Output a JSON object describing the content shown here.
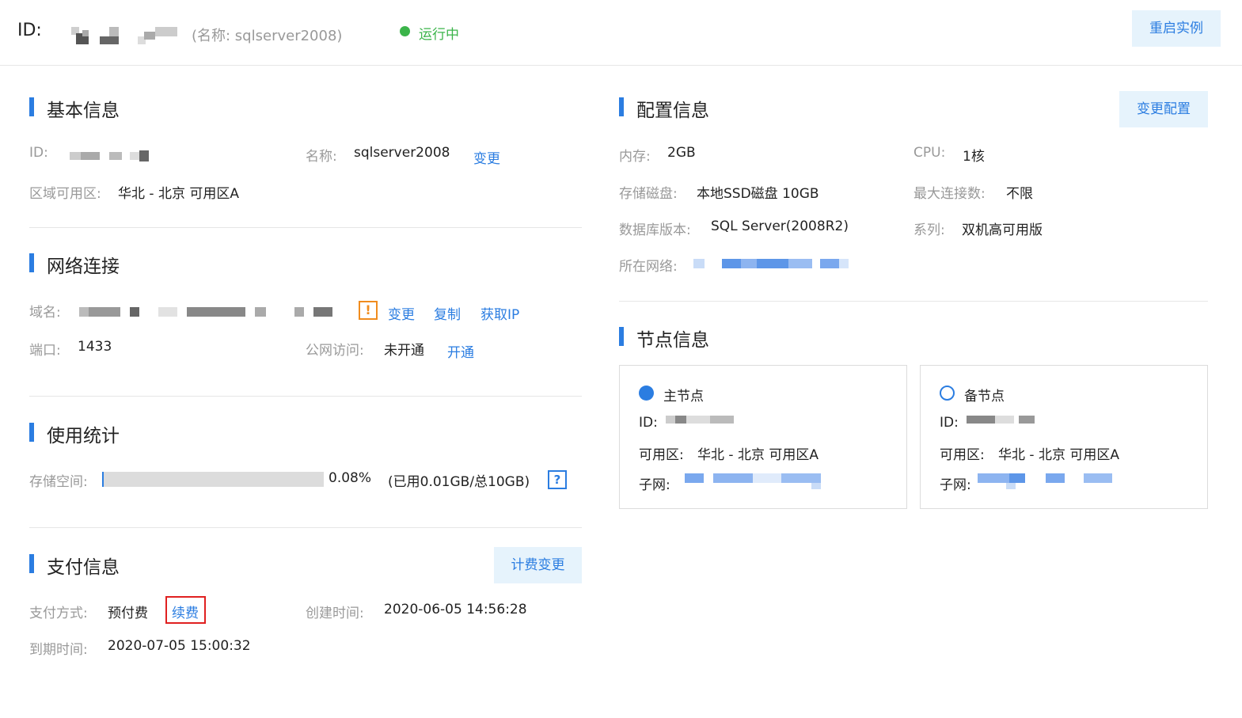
{
  "header": {
    "id_label": "ID:",
    "instance_name": "(名称: sqlserver2008)",
    "status": "运行中",
    "status_color": "#3bb44a",
    "restart_button": "重启实例"
  },
  "basic_info": {
    "title": "基本信息",
    "id_label": "ID:",
    "name_label": "名称:",
    "name_value": "sqlserver2008",
    "name_change_link": "变更",
    "region_label": "区域可用区:",
    "region_value": "华北 - 北京 可用区A"
  },
  "network": {
    "title": "网络连接",
    "domain_label": "域名:",
    "warn_icon": "!",
    "change_link": "变更",
    "copy_link": "复制",
    "get_ip_link": "获取IP",
    "port_label": "端口:",
    "port_value": "1433",
    "public_access_label": "公网访问:",
    "public_access_value": "未开通",
    "enable_link": "开通"
  },
  "usage": {
    "title": "使用统计",
    "storage_label": "存储空间:",
    "storage_percent": "0.08%",
    "storage_fraction": 0.0008,
    "storage_detail": "(已用0.01GB/总10GB)",
    "help_icon": "?"
  },
  "payment": {
    "title": "支付信息",
    "billing_change_button": "计费变更",
    "method_label": "支付方式:",
    "method_value": "预付费",
    "renew_link": "续费",
    "created_label": "创建时间:",
    "created_value": "2020-06-05 14:56:28",
    "expire_label": "到期时间:",
    "expire_value": "2020-07-05 15:00:32"
  },
  "config": {
    "title": "配置信息",
    "change_config_button": "变更配置",
    "memory_label": "内存:",
    "memory_value": "2GB",
    "cpu_label": "CPU:",
    "cpu_value": "1核",
    "disk_label": "存储磁盘:",
    "disk_value": "本地SSD磁盘 10GB",
    "max_conn_label": "最大连接数:",
    "max_conn_value": "不限",
    "db_version_label": "数据库版本:",
    "db_version_value": "SQL Server(2008R2)",
    "series_label": "系列:",
    "series_value": "双机高可用版",
    "network_label": "所在网络:"
  },
  "nodes": {
    "title": "节点信息",
    "primary": {
      "title": "主节点",
      "id_label": "ID:",
      "zone_label": "可用区:",
      "zone_value": "华北 - 北京 可用区A",
      "subnet_label": "子网:"
    },
    "standby": {
      "title": "备节点",
      "id_label": "ID:",
      "zone_label": "可用区:",
      "zone_value": "华北 - 北京 可用区A",
      "subnet_label": "子网:"
    }
  },
  "colors": {
    "accent": "#2b7de1",
    "warning": "#f08c1e",
    "highlight_box": "#e02020"
  }
}
